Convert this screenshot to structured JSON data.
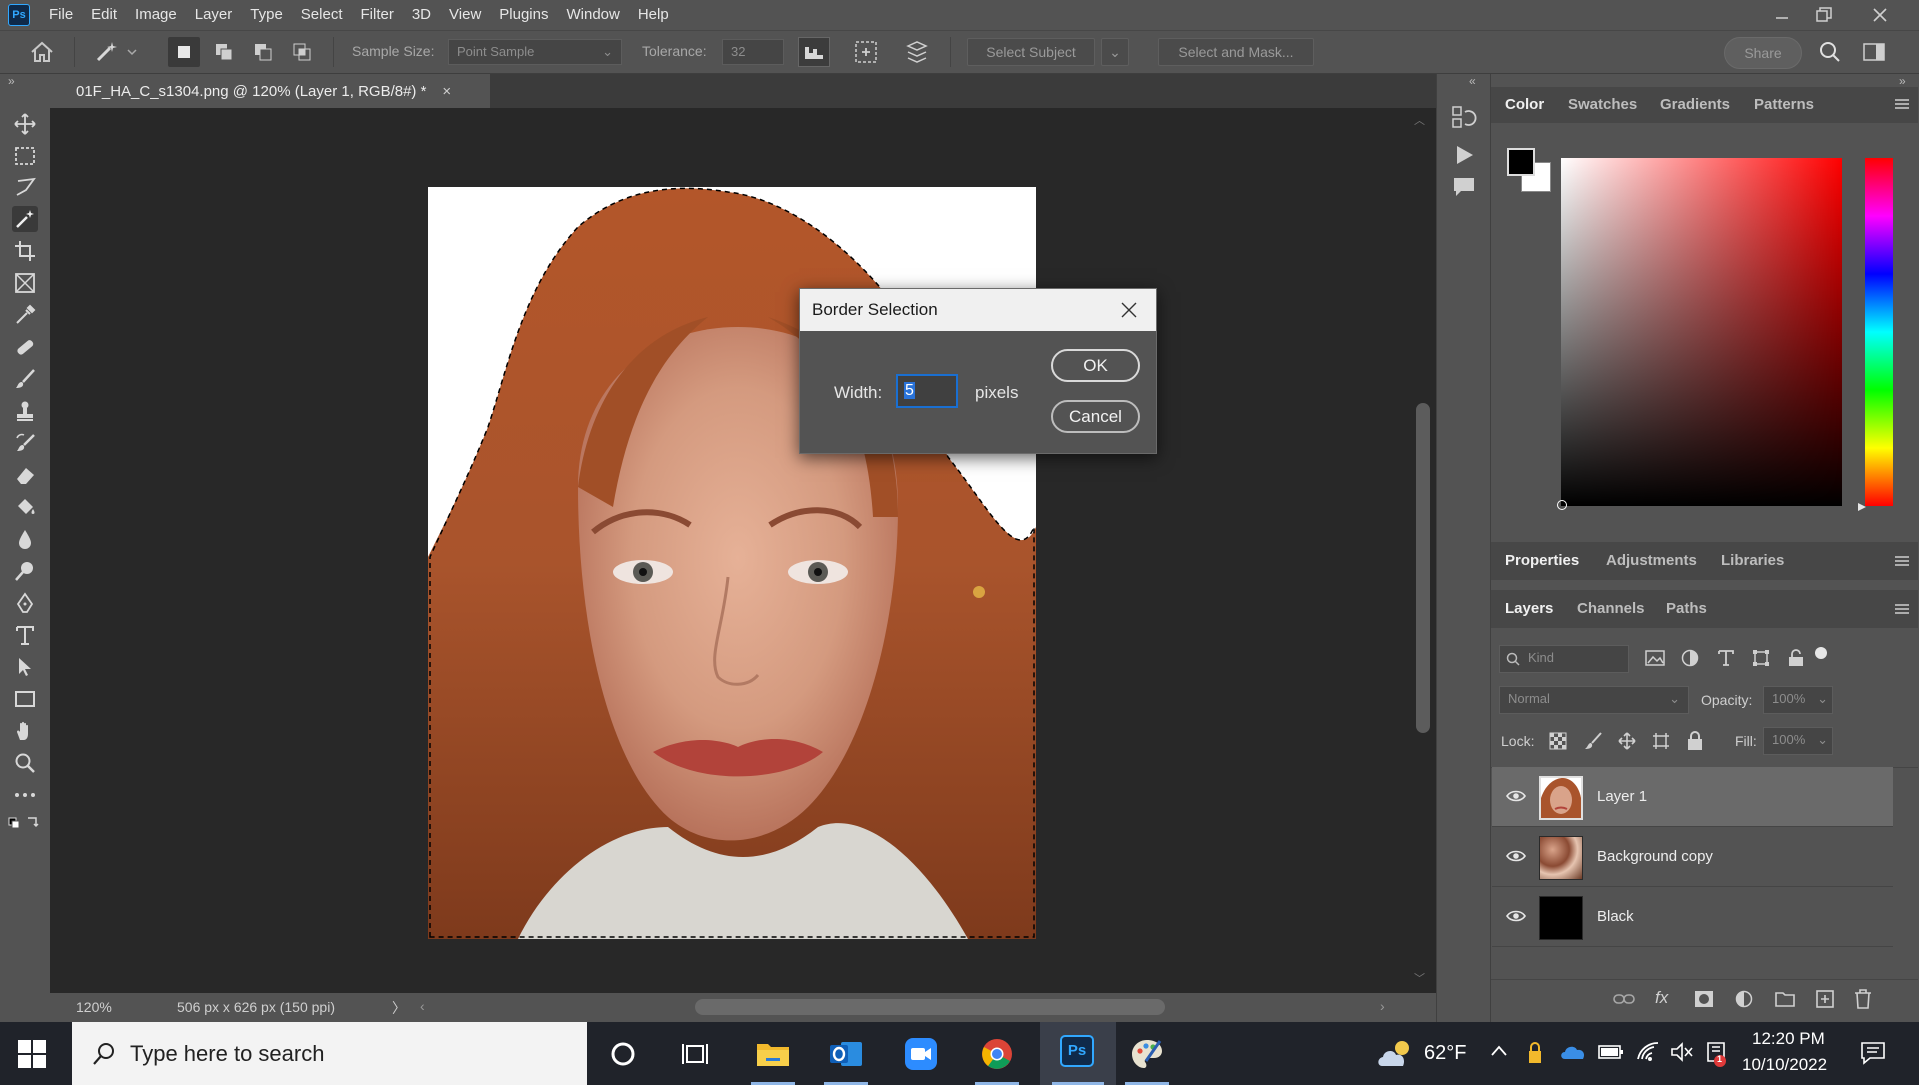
{
  "app": {
    "logo": "Ps"
  },
  "menu": [
    "File",
    "Edit",
    "Image",
    "Layer",
    "Type",
    "Select",
    "Filter",
    "3D",
    "View",
    "Plugins",
    "Window",
    "Help"
  ],
  "options_bar": {
    "sample_size_label": "Sample Size:",
    "sample_size_value": "Point Sample",
    "tolerance_label": "Tolerance:",
    "tolerance_value": "32",
    "select_subject": "Select Subject",
    "select_and_mask": "Select and Mask...",
    "share": "Share"
  },
  "document": {
    "tab_title": "01F_HA_C_s1304.png @ 120% (Layer 1, RGB/8#) *",
    "close_symbol": "×"
  },
  "status": {
    "zoom": "120%",
    "doc_info": "506 px x 626 px (150 ppi)",
    "arrow": "〉"
  },
  "dialog": {
    "title": "Border Selection",
    "width_label": "Width:",
    "width_value": "5",
    "unit": "pixels",
    "ok": "OK",
    "cancel": "Cancel"
  },
  "color_panel": {
    "tabs": [
      "Color",
      "Swatches",
      "Gradients",
      "Patterns"
    ],
    "active_tab": "Color",
    "foreground": "#000000",
    "background": "#ffffff",
    "hue_base": "#ff0000"
  },
  "properties_panel": {
    "tabs": [
      "Properties",
      "Adjustments",
      "Libraries"
    ]
  },
  "layers_panel": {
    "tabs": [
      "Layers",
      "Channels",
      "Paths"
    ],
    "filter_placeholder": "Kind",
    "blend_mode": "Normal",
    "opacity_label": "Opacity:",
    "opacity_value": "100%",
    "lock_label": "Lock:",
    "fill_label": "Fill:",
    "fill_value": "100%",
    "layers": [
      {
        "name": "Layer 1",
        "selected": true,
        "visible": true
      },
      {
        "name": "Background copy",
        "selected": false,
        "visible": true
      },
      {
        "name": "Black",
        "selected": false,
        "visible": true
      }
    ],
    "footer_fx": "fx"
  },
  "taskbar": {
    "search_placeholder": "Type here to search",
    "weather_temp": "62°F",
    "time": "12:20 PM",
    "date": "10/10/2022",
    "notification_count": "1"
  }
}
